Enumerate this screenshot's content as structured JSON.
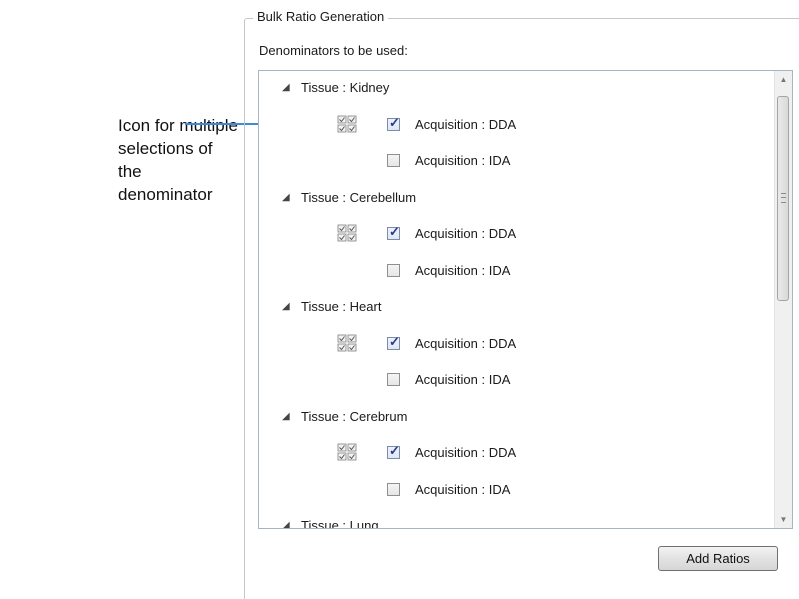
{
  "callout": {
    "text_line1": "Icon for multiple",
    "text_line2": "selections of the",
    "text_line3": "denominator",
    "line_color": "#3d8ad6"
  },
  "groupbox": {
    "title": "Bulk Ratio Generation",
    "subtitle": "Denominators to be used:"
  },
  "tree": {
    "groups": [
      {
        "label": "Tissue : Kidney",
        "items": [
          {
            "label": "Acquisition : DDA",
            "checked": true,
            "multi_icon": true
          },
          {
            "label": "Acquisition : IDA",
            "checked": false,
            "multi_icon": false
          }
        ]
      },
      {
        "label": "Tissue : Cerebellum",
        "items": [
          {
            "label": "Acquisition : DDA",
            "checked": true,
            "multi_icon": true
          },
          {
            "label": "Acquisition : IDA",
            "checked": false,
            "multi_icon": false
          }
        ]
      },
      {
        "label": "Tissue : Heart",
        "items": [
          {
            "label": "Acquisition : DDA",
            "checked": true,
            "multi_icon": true
          },
          {
            "label": "Acquisition : IDA",
            "checked": false,
            "multi_icon": false
          }
        ]
      },
      {
        "label": "Tissue : Cerebrum",
        "items": [
          {
            "label": "Acquisition : DDA",
            "checked": true,
            "multi_icon": true
          },
          {
            "label": "Acquisition : IDA",
            "checked": false,
            "multi_icon": false
          }
        ]
      },
      {
        "label": "Tissue : Lung",
        "items": []
      }
    ],
    "expander_glyph": "◢",
    "checkmark_glyph": "✓",
    "scroll_up_glyph": "▲",
    "scroll_down_glyph": "▼"
  },
  "buttons": {
    "add_ratios": "Add Ratios"
  },
  "icons": {
    "expander": "triangle-expanded-icon",
    "multi": "multi-select-grid-icon",
    "checkbox": "checkbox-icon"
  }
}
